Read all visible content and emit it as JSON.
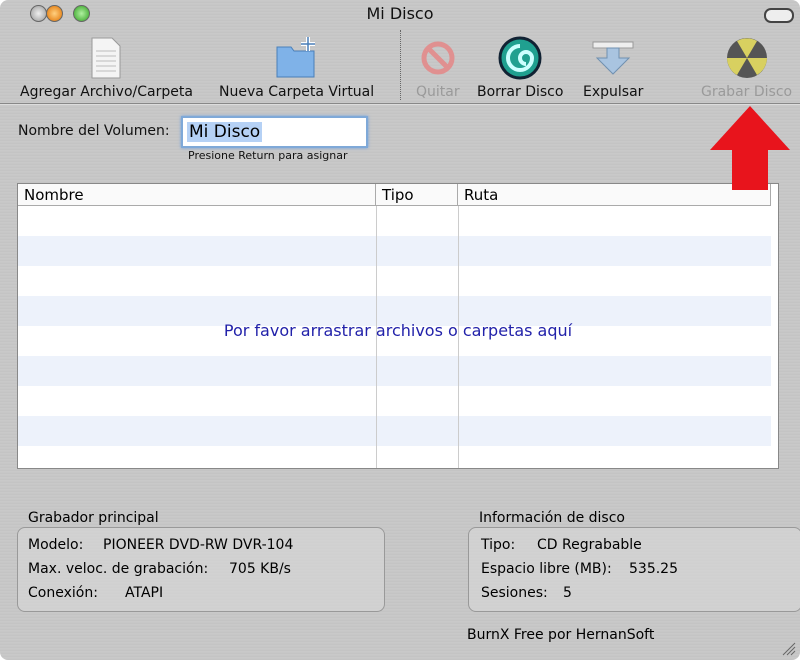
{
  "window": {
    "title": "Mi Disco"
  },
  "toolbar": {
    "add": "Agregar Archivo/Carpeta",
    "new_folder": "Nueva Carpeta Virtual",
    "remove": "Quitar",
    "erase": "Borrar Disco",
    "eject": "Expulsar",
    "burn": "Grabar Disco"
  },
  "volume": {
    "label": "Nombre del Volumen:",
    "value": "Mi Disco",
    "hint": "Presione Return para asignar"
  },
  "table": {
    "columns": [
      "Nombre",
      "Tipo",
      "Ruta"
    ],
    "empty_message": "Por favor arrastrar archivos o carpetas aquí"
  },
  "recorder": {
    "title": "Grabador principal",
    "model_label": "Modelo:",
    "model": "PIONEER DVD-RW DVR-104",
    "speed_label": "Max. veloc. de grabación:",
    "speed": "705 KB/s",
    "conn_label": "Conexión:",
    "conn": "ATAPI"
  },
  "disc": {
    "title": "Información de disco",
    "type_label": "Tipo:",
    "type": "CD Regrabable",
    "free_label": "Espacio libre (MB):",
    "free": "535.25",
    "sessions_label": "Sesiones:",
    "sessions": "5"
  },
  "footer": {
    "credit": "BurnX Free por HernanSoft"
  },
  "colors": {
    "annotation_arrow": "#e8141c",
    "drop_text": "#2222aa"
  }
}
